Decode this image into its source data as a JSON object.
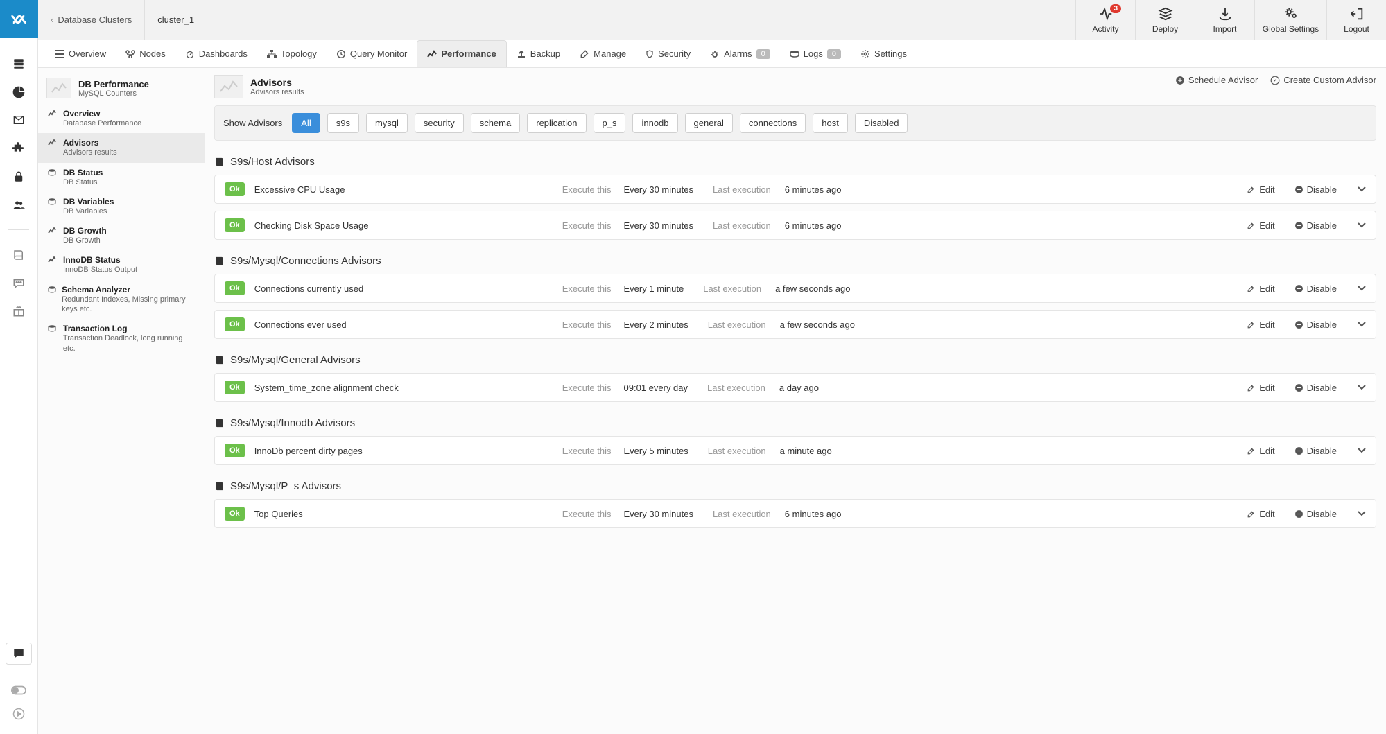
{
  "breadcrumb": {
    "back_label": "Database Clusters",
    "cluster_name": "cluster_1"
  },
  "topactions": {
    "activity": "Activity",
    "activity_badge": "3",
    "deploy": "Deploy",
    "import": "Import",
    "global": "Global Settings",
    "logout": "Logout"
  },
  "tabs": {
    "overview": "Overview",
    "nodes": "Nodes",
    "dashboards": "Dashboards",
    "topology": "Topology",
    "query_monitor": "Query Monitor",
    "performance": "Performance",
    "backup": "Backup",
    "manage": "Manage",
    "security": "Security",
    "alarms": "Alarms",
    "alarms_count": "0",
    "logs": "Logs",
    "logs_count": "0",
    "settings": "Settings"
  },
  "sidehead": {
    "title": "DB Performance",
    "sub": "MySQL Counters"
  },
  "sidebar": [
    {
      "title": "Overview",
      "sub": "Database Performance"
    },
    {
      "title": "Advisors",
      "sub": "Advisors results"
    },
    {
      "title": "DB Status",
      "sub": "DB Status"
    },
    {
      "title": "DB Variables",
      "sub": "DB Variables"
    },
    {
      "title": "DB Growth",
      "sub": "DB Growth"
    },
    {
      "title": "InnoDB Status",
      "sub": "InnoDB Status Output"
    },
    {
      "title": "Schema Analyzer",
      "sub": "Redundant Indexes, Missing primary keys etc."
    },
    {
      "title": "Transaction Log",
      "sub": "Transaction Deadlock, long running etc."
    }
  ],
  "contenthead": {
    "title": "Advisors",
    "sub": "Advisors results",
    "schedule": "Schedule Advisor",
    "create": "Create Custom Advisor"
  },
  "filter": {
    "label": "Show Advisors",
    "all": "All",
    "s9s": "s9s",
    "mysql": "mysql",
    "security": "security",
    "schema": "schema",
    "replication": "replication",
    "p_s": "p_s",
    "innodb": "innodb",
    "general": "general",
    "connections": "connections",
    "host": "host",
    "disabled": "Disabled"
  },
  "labels": {
    "execute_this": "Execute this",
    "last_execution": "Last execution",
    "edit": "Edit",
    "disable": "Disable",
    "ok": "Ok"
  },
  "sections": [
    {
      "title": "S9s/Host Advisors",
      "rows": [
        {
          "name": "Excessive CPU Usage",
          "exec": "Every 30 minutes",
          "last": "6 minutes ago"
        },
        {
          "name": "Checking Disk Space Usage",
          "exec": "Every 30 minutes",
          "last": "6 minutes ago"
        }
      ]
    },
    {
      "title": "S9s/Mysql/Connections Advisors",
      "rows": [
        {
          "name": "Connections currently used",
          "exec": "Every 1 minute",
          "last": "a few seconds ago"
        },
        {
          "name": "Connections ever used",
          "exec": "Every 2 minutes",
          "last": "a few seconds ago"
        }
      ]
    },
    {
      "title": "S9s/Mysql/General Advisors",
      "rows": [
        {
          "name": "System_time_zone alignment check",
          "exec": "09:01 every day",
          "last": "a day ago"
        }
      ]
    },
    {
      "title": "S9s/Mysql/Innodb Advisors",
      "rows": [
        {
          "name": "InnoDb percent dirty pages",
          "exec": "Every 5 minutes",
          "last": "a minute ago"
        }
      ]
    },
    {
      "title": "S9s/Mysql/P_s Advisors",
      "rows": [
        {
          "name": "Top Queries",
          "exec": "Every 30 minutes",
          "last": "6 minutes ago"
        }
      ]
    }
  ]
}
